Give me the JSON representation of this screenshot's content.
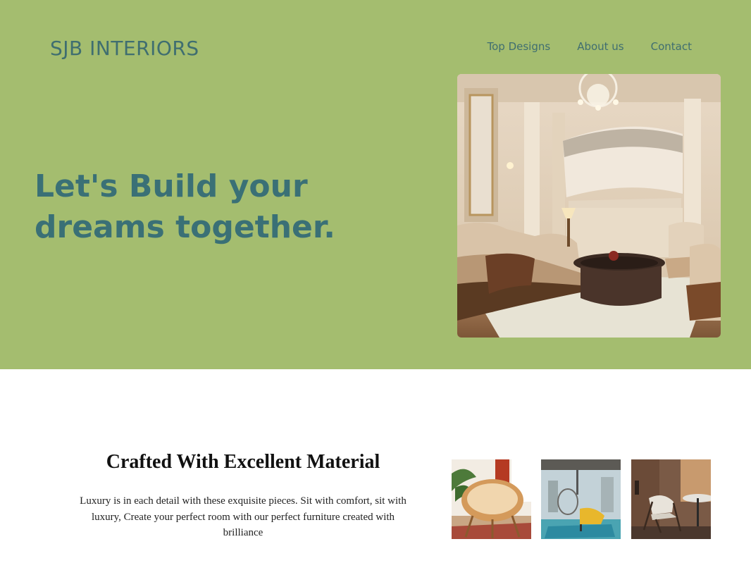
{
  "brand": {
    "name": "SJB INTERIORS"
  },
  "nav": {
    "items": [
      "Top Designs",
      "About us",
      "Contact"
    ]
  },
  "hero": {
    "headline_line1": "Let's Build your",
    "headline_line2": "dreams together.",
    "image": "luxury-living-room-photo"
  },
  "features": {
    "title": "Crafted With Excellent Material",
    "description": "Luxury is in each detail with these exquisite pieces. Sit with comfort, sit with luxury, Create your perfect room with our perfect furniture created with brilliance",
    "thumbnails": [
      "papasan-chair-photo",
      "hanging-chair-photo",
      "lounge-chair-photo"
    ]
  },
  "colors": {
    "hero_background": "#a4bd6f",
    "brand_text": "#3f6e70",
    "headline_text": "#3a7076"
  }
}
